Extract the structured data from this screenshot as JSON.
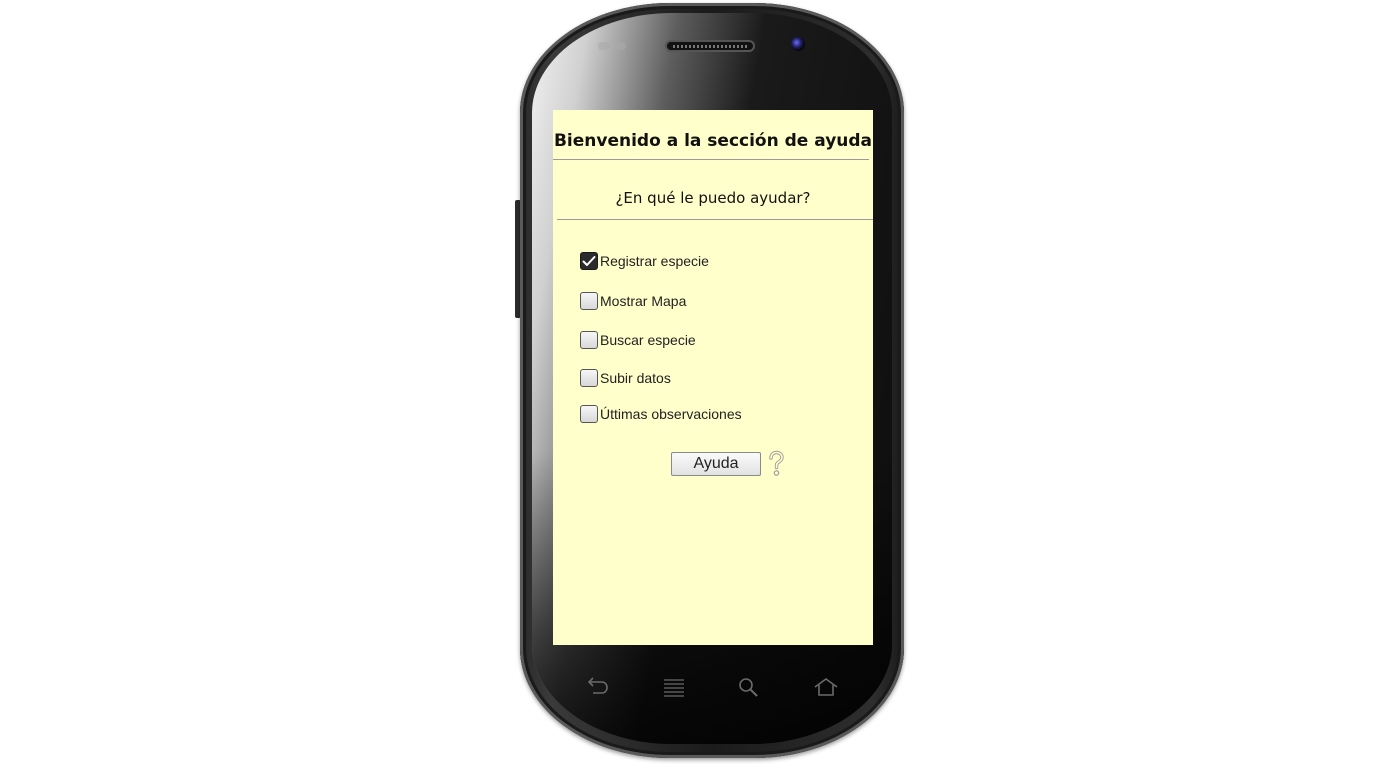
{
  "screen": {
    "title": "Bienvenido a la sección de ayuda",
    "subtitle": "¿En qué le puedo ayudar?",
    "background_color": "#ffffcc"
  },
  "options": [
    {
      "label": "Registrar especie",
      "checked": true
    },
    {
      "label": "Mostrar Mapa",
      "checked": false
    },
    {
      "label": "Buscar especie",
      "checked": false
    },
    {
      "label": "Subir datos",
      "checked": false
    },
    {
      "label": "Úttimas observaciones",
      "checked": false
    }
  ],
  "help_button": {
    "label": "Ayuda"
  },
  "icons": {
    "help": "question-mark-icon",
    "back": "back-icon",
    "menu": "menu-icon",
    "search": "search-icon",
    "home": "home-icon"
  }
}
